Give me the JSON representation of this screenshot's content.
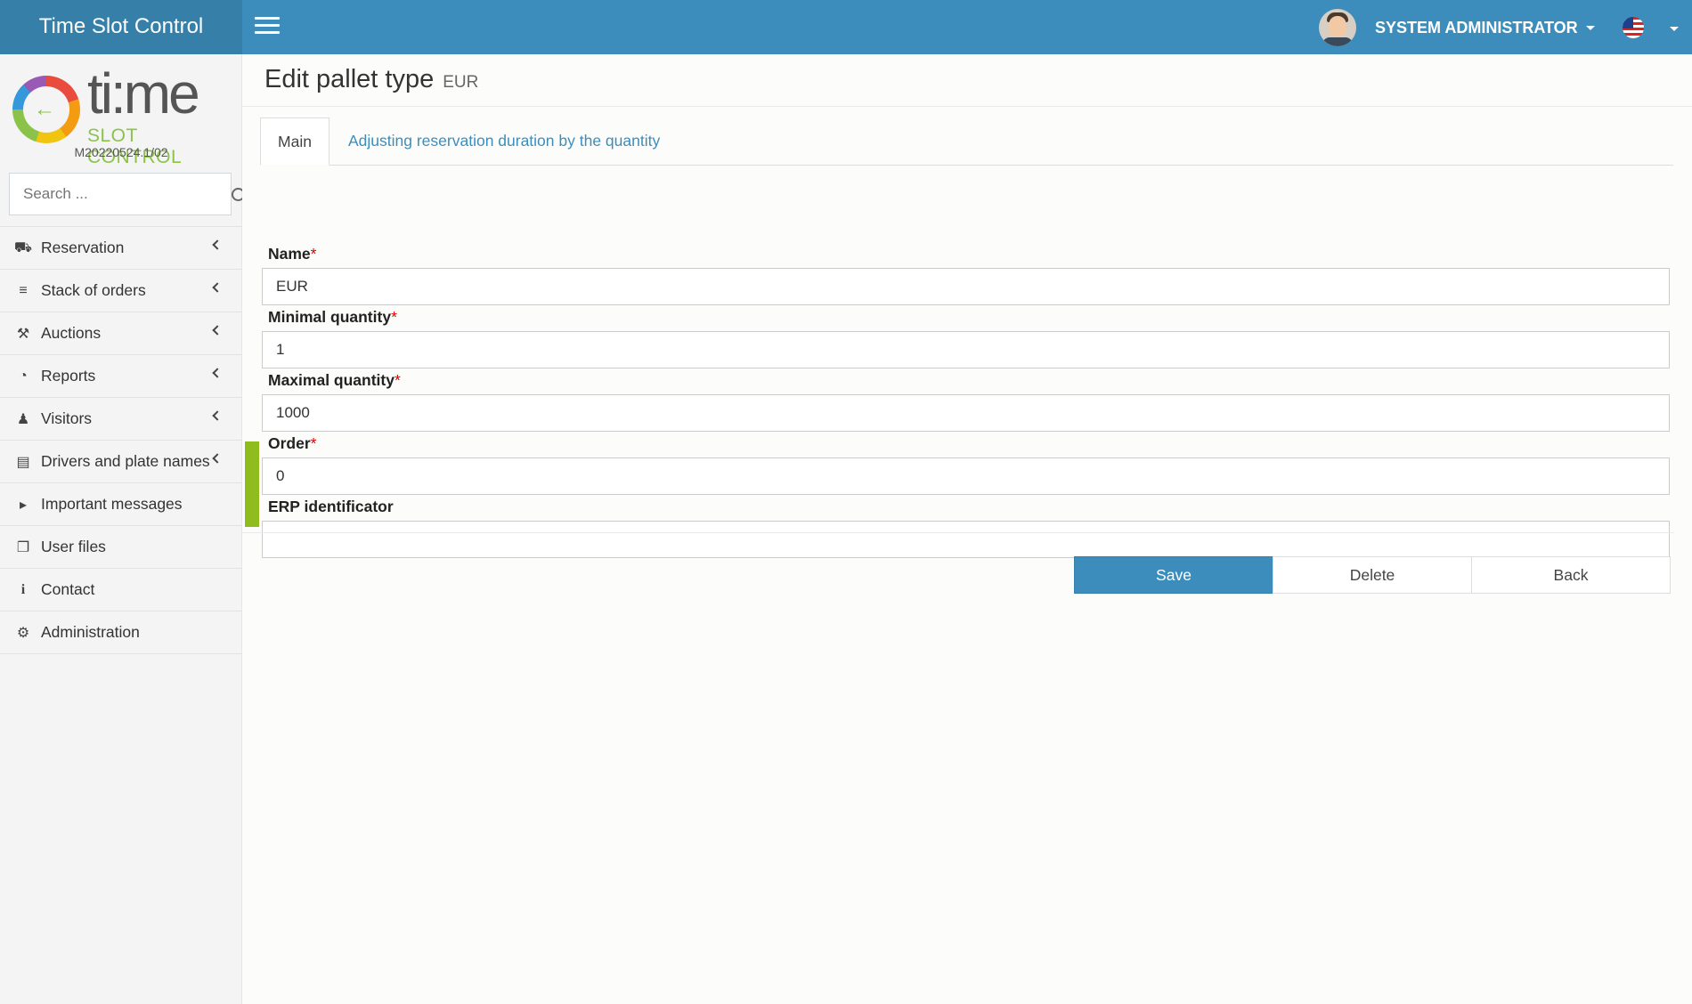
{
  "header": {
    "brand": "Time Slot Control",
    "user_name": "SYSTEM ADMINISTRATOR",
    "language_flag": "us-flag-icon",
    "accent_color": "#3c8dbc"
  },
  "sidebar": {
    "logo_text": "ti:me",
    "logo_subtitle": "SLOT CONTROL",
    "version": "M20220524.1/02",
    "search_placeholder": "Search ...",
    "items": [
      {
        "label": "Reservation",
        "icon": "truck-icon",
        "has_children": true
      },
      {
        "label": "Stack of orders",
        "icon": "stack-icon",
        "has_children": true
      },
      {
        "label": "Auctions",
        "icon": "gavel-icon",
        "has_children": true
      },
      {
        "label": "Reports",
        "icon": "pie-chart-icon",
        "has_children": true
      },
      {
        "label": "Visitors",
        "icon": "users-icon",
        "has_children": true
      },
      {
        "label": "Drivers and plate names",
        "icon": "id-card-icon",
        "has_children": true
      },
      {
        "label": "Important messages",
        "icon": "megaphone-icon",
        "has_children": false
      },
      {
        "label": "User files",
        "icon": "files-icon",
        "has_children": false
      },
      {
        "label": "Contact",
        "icon": "info-icon",
        "has_children": false
      },
      {
        "label": "Administration",
        "icon": "gear-icon",
        "has_children": false
      }
    ]
  },
  "page": {
    "title": "Edit pallet type",
    "subtitle": "EUR",
    "tabs": [
      {
        "label": "Main",
        "active": true
      },
      {
        "label": "Adjusting reservation duration by the quantity",
        "active": false
      }
    ]
  },
  "form": {
    "required_mark": "*",
    "name": {
      "label": "Name",
      "value": "EUR"
    },
    "min_qty": {
      "label": "Minimal quantity",
      "value": "1"
    },
    "max_qty": {
      "label": "Maximal quantity",
      "value": "1000"
    },
    "order": {
      "label": "Order",
      "value": "0"
    },
    "erp": {
      "label": "ERP identificator",
      "value": ""
    }
  },
  "actions": {
    "save": "Save",
    "delete": "Delete",
    "back": "Back"
  }
}
